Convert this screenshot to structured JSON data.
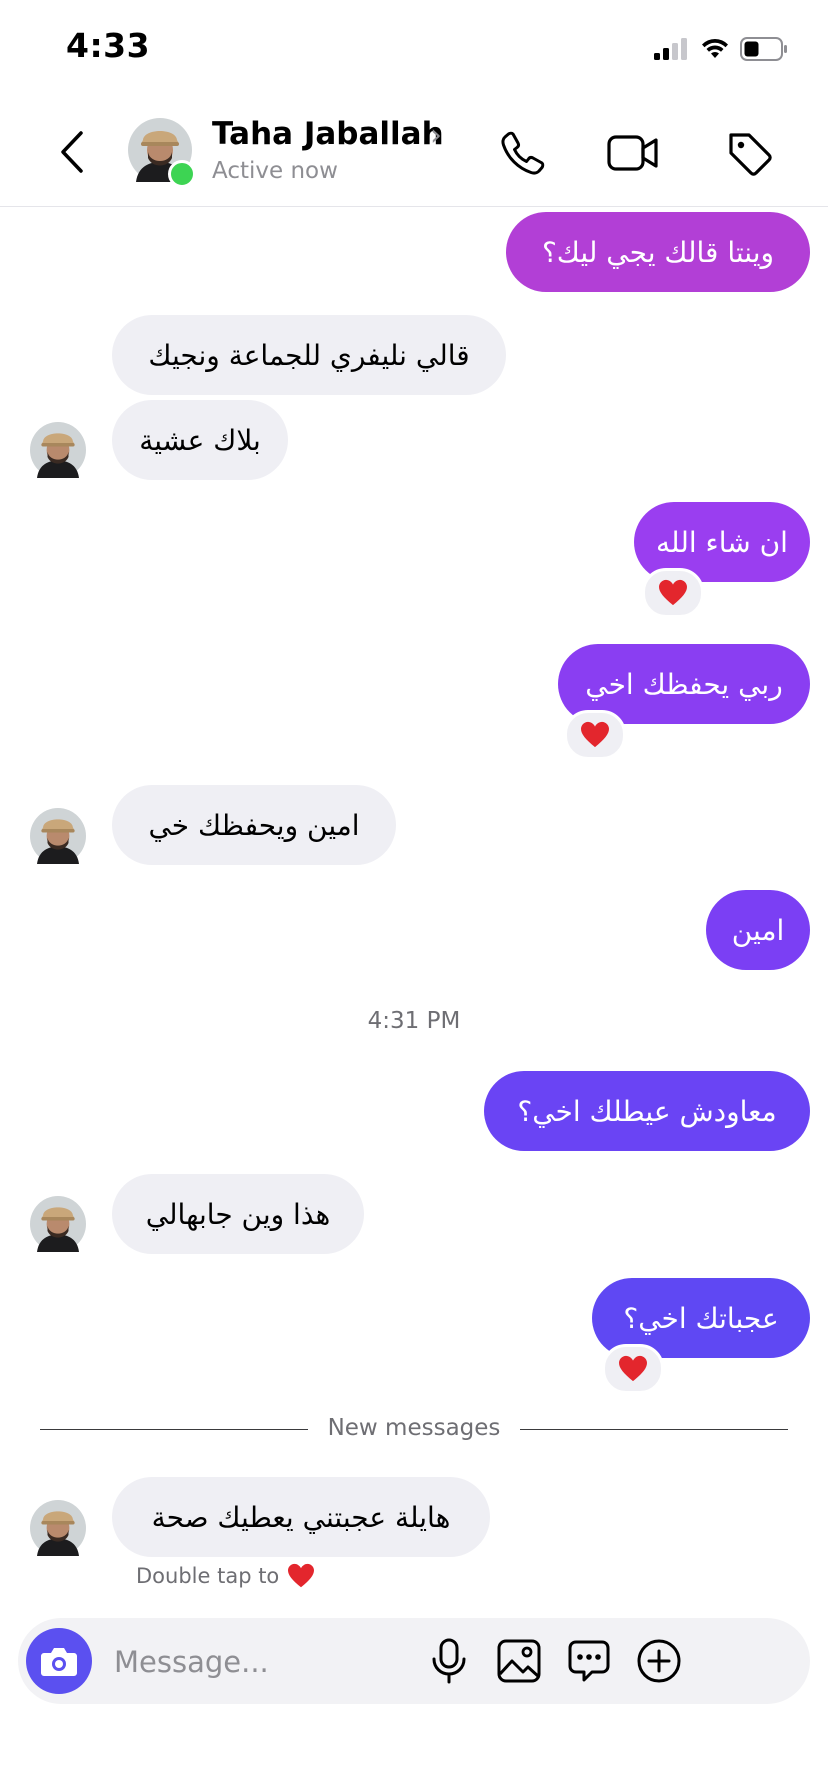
{
  "status_bar": {
    "time": "4:33"
  },
  "header": {
    "contact_name": "Taha Jaballah",
    "presence": "Active now",
    "icons": [
      "back-icon",
      "phone-icon",
      "video-camera-icon",
      "tag-icon"
    ]
  },
  "messages": [
    {
      "direction": "outgoing",
      "text": "وينتا قالك يجي ليك؟",
      "color": "#b23fd6"
    },
    {
      "direction": "incoming",
      "text": "قالي نليفري للجماعة ونجيك"
    },
    {
      "direction": "incoming",
      "text": "بلاك عشية"
    },
    {
      "direction": "outgoing",
      "text": "ان شاء الله",
      "color": "#9a3ef0",
      "reaction": "❤️"
    },
    {
      "direction": "outgoing",
      "text": "ربي يحفظك اخي",
      "color": "#8a3ef2",
      "reaction": "❤️"
    },
    {
      "direction": "incoming",
      "text": "امين ويحفظك خي"
    },
    {
      "direction": "outgoing",
      "text": "امين",
      "color": "#7b3ff4"
    },
    {
      "direction": "outgoing",
      "text": "معاودش عيطلك اخي؟",
      "color": "#6a44f4"
    },
    {
      "direction": "incoming",
      "text": "هذا وين جابهالي"
    },
    {
      "direction": "outgoing",
      "text": "عجباتك اخي؟",
      "color": "#5f48f3",
      "reaction": "❤️"
    },
    {
      "direction": "incoming",
      "text": "هايلة عجبتني يعطيك صحة"
    }
  ],
  "timestamp": "4:31 PM",
  "divider_label": "New messages",
  "double_tap_hint": "Double tap to",
  "composer": {
    "placeholder": "Message...",
    "icons": [
      "camera-icon",
      "microphone-icon",
      "gallery-icon",
      "sticker-chat-icon",
      "plus-circle-icon"
    ]
  },
  "colors": {
    "accent": "#5b50f0",
    "incoming_bubble": "#efeff4",
    "online": "#3dd453",
    "heart": "#e3262d"
  }
}
